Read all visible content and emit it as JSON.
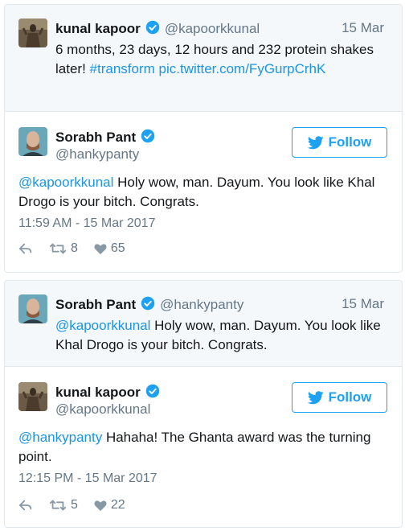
{
  "card1": {
    "context": {
      "name": "kunal kapoor",
      "handle": "@kapoorkkunal",
      "date": "15 Mar",
      "text_plain": "6 months, 23 days, 12 hours and 232 protein shakes later!",
      "hashtag": "#transform",
      "pic_link": "pic.twitter.com/FyGurpCrhK"
    },
    "main": {
      "name": "Sorabh Pant",
      "handle": "@hankypanty",
      "follow_label": "Follow",
      "mention": "@kapoorkkunal",
      "text": "Holy wow, man. Dayum. You look like Khal Drogo is your bitch. Congrats.",
      "timestamp": "11:59 AM - 15 Mar 2017",
      "retweets": "8",
      "likes": "65"
    }
  },
  "card2": {
    "context": {
      "name": "Sorabh Pant",
      "handle": "@hankypanty",
      "date": "15 Mar",
      "mention": "@kapoorkkunal",
      "text": "Holy wow, man. Dayum. You look like Khal Drogo is your bitch. Congrats."
    },
    "main": {
      "name": "kunal kapoor",
      "handle": "@kapoorkkunal",
      "follow_label": "Follow",
      "mention": "@hankypanty",
      "text": "Hahaha! The Ghanta award was the turning point.",
      "timestamp": "12:15 PM - 15 Mar 2017",
      "retweets": "5",
      "likes": "22"
    }
  },
  "colors": {
    "link": "#1b95e0",
    "verified": "#1da1f2",
    "muted": "#657786",
    "border": "#e1e8ed",
    "context_bg": "#f5f8fa"
  },
  "icons": [
    "verified-badge-icon",
    "twitter-bird-icon",
    "reply-icon",
    "retweet-icon",
    "heart-icon"
  ]
}
